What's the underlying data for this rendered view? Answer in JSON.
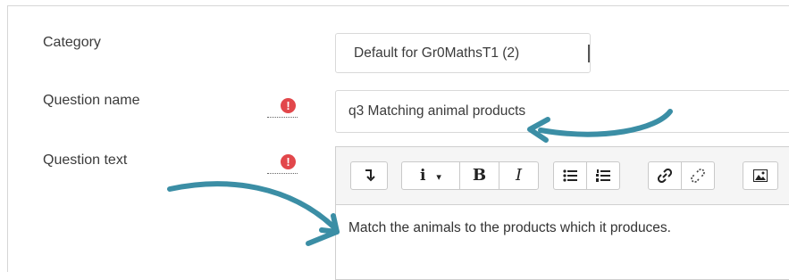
{
  "form": {
    "category": {
      "label": "Category",
      "value": "Default for Gr0MathsT1 (2)"
    },
    "question_name": {
      "label": "Question name",
      "value": "q3 Matching animal products",
      "required_marker": "!"
    },
    "question_text": {
      "label": "Question text",
      "value": "Match the animals to the products which it produces.",
      "required_marker": "!"
    }
  },
  "toolbar": {
    "collapse": "↧",
    "info": "i",
    "info_caret": "▾",
    "bold": "B",
    "italic": "I",
    "icons": [
      "collapse-icon",
      "info-icon",
      "bold-icon",
      "italic-icon",
      "bullet-list-icon",
      "numbered-list-icon",
      "link-icon",
      "unlink-icon",
      "image-icon"
    ]
  },
  "colors": {
    "arrow": "#3b8ea5",
    "required": "#e2474b"
  }
}
